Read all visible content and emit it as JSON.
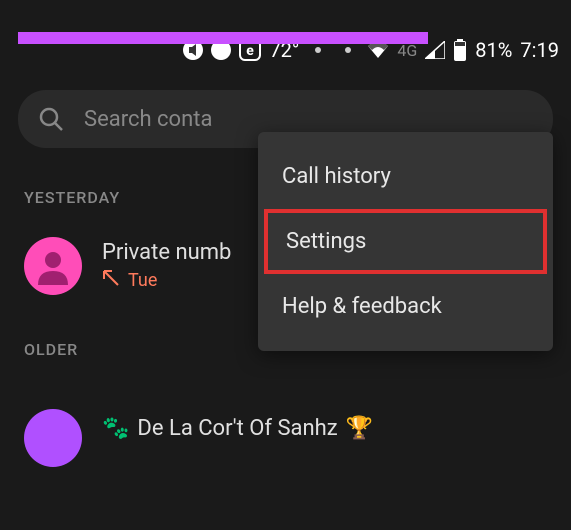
{
  "status_bar": {
    "temperature": "72°",
    "network_label": "4G",
    "battery_percent": "81%",
    "time": "7:19"
  },
  "search": {
    "placeholder": "Search conta"
  },
  "menu": {
    "items": [
      {
        "label": "Call history"
      },
      {
        "label": "Settings"
      },
      {
        "label": "Help & feedback"
      }
    ]
  },
  "sections": {
    "yesterday": {
      "header": "YESTERDAY",
      "calls": [
        {
          "name": "Private numb",
          "day": "Tue"
        }
      ]
    },
    "older": {
      "header": "OLDER",
      "calls": [
        {
          "prefix_emoji": "🐾",
          "name": "De La Cor't Of Sanhz",
          "suffix_emoji": "🏆"
        }
      ]
    }
  }
}
